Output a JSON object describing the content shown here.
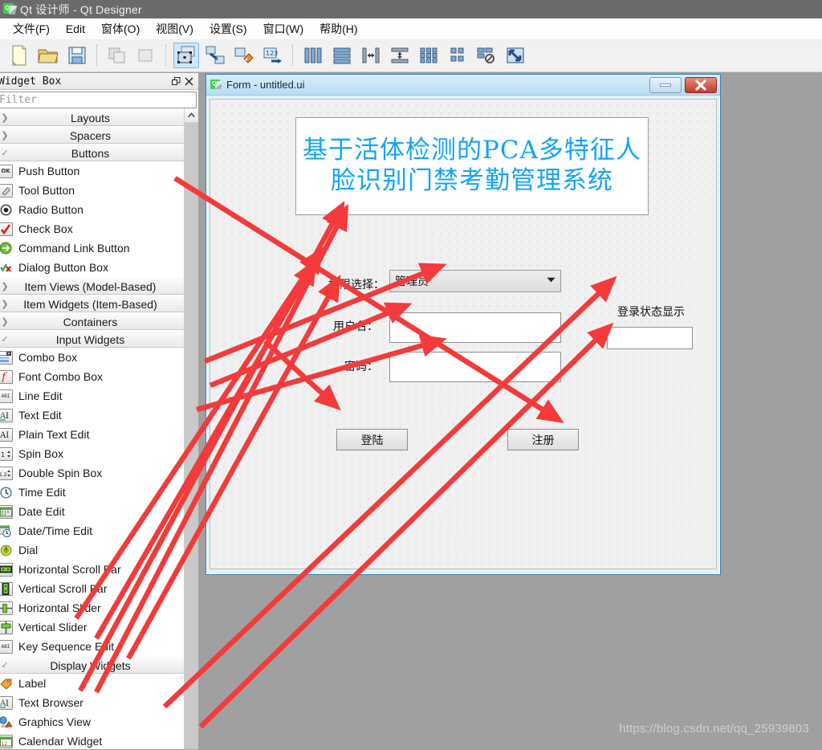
{
  "app": {
    "title": "Qt 设计师 - Qt Designer",
    "logo_text": "Qt"
  },
  "menubar": {
    "items": [
      {
        "label": "文件(F)",
        "mnemonic": "F"
      },
      {
        "label": "Edit",
        "mnemonic": "E"
      },
      {
        "label": "窗体(O)",
        "mnemonic": "O"
      },
      {
        "label": "视图(V)",
        "mnemonic": "V"
      },
      {
        "label": "设置(S)",
        "mnemonic": "S"
      },
      {
        "label": "窗口(W)",
        "mnemonic": "W"
      },
      {
        "label": "帮助(H)",
        "mnemonic": "H"
      }
    ]
  },
  "toolbar": {
    "buttons": [
      {
        "icon": "new-file-icon",
        "active": false
      },
      {
        "icon": "open-folder-icon",
        "active": false
      },
      {
        "icon": "save-icon",
        "active": false
      },
      {
        "icon": "undo-icon",
        "active": false
      },
      {
        "icon": "redo-icon",
        "active": false
      },
      {
        "icon": "edit-widgets-icon",
        "active": true
      },
      {
        "icon": "edit-signals-slots-icon",
        "active": false
      },
      {
        "icon": "edit-buddies-icon",
        "active": false
      },
      {
        "icon": "edit-tab-order-icon",
        "active": false
      },
      {
        "icon": "layout-horizontally-icon",
        "active": false
      },
      {
        "icon": "layout-vertically-icon",
        "active": false
      },
      {
        "icon": "layout-splitter-horizontal-icon",
        "active": false
      },
      {
        "icon": "layout-splitter-vertical-icon",
        "active": false
      },
      {
        "icon": "layout-grid-icon",
        "active": false
      },
      {
        "icon": "layout-form-icon",
        "active": false
      },
      {
        "icon": "break-layout-icon",
        "active": false
      },
      {
        "icon": "adjust-size-icon",
        "active": false
      }
    ]
  },
  "widget_box": {
    "title": "Widget Box",
    "filter_placeholder": "Filter",
    "float_icon": "float-icon",
    "close_icon": "close-icon",
    "scroll_up_icon": "chevron-up-icon",
    "entries": [
      {
        "kind": "category",
        "label": "Layouts",
        "expanded": false
      },
      {
        "kind": "category",
        "label": "Spacers",
        "expanded": false
      },
      {
        "kind": "category",
        "label": "Buttons",
        "expanded": true
      },
      {
        "kind": "item",
        "label": "Push Button",
        "icon": "push-button-icon"
      },
      {
        "kind": "item",
        "label": "Tool Button",
        "icon": "tool-button-icon"
      },
      {
        "kind": "item",
        "label": "Radio Button",
        "icon": "radio-button-icon"
      },
      {
        "kind": "item",
        "label": "Check Box",
        "icon": "check-box-icon"
      },
      {
        "kind": "item",
        "label": "Command Link Button",
        "icon": "command-link-button-icon"
      },
      {
        "kind": "item",
        "label": "Dialog Button Box",
        "icon": "dialog-button-box-icon"
      },
      {
        "kind": "category",
        "label": "Item Views (Model-Based)",
        "expanded": false
      },
      {
        "kind": "category",
        "label": "Item Widgets (Item-Based)",
        "expanded": false
      },
      {
        "kind": "category",
        "label": "Containers",
        "expanded": false
      },
      {
        "kind": "category",
        "label": "Input Widgets",
        "expanded": true
      },
      {
        "kind": "item",
        "label": "Combo Box",
        "icon": "combo-box-icon"
      },
      {
        "kind": "item",
        "label": "Font Combo Box",
        "icon": "font-combo-box-icon"
      },
      {
        "kind": "item",
        "label": "Line Edit",
        "icon": "line-edit-icon"
      },
      {
        "kind": "item",
        "label": "Text Edit",
        "icon": "text-edit-icon"
      },
      {
        "kind": "item",
        "label": "Plain Text Edit",
        "icon": "plain-text-edit-icon"
      },
      {
        "kind": "item",
        "label": "Spin Box",
        "icon": "spin-box-icon"
      },
      {
        "kind": "item",
        "label": "Double Spin Box",
        "icon": "double-spin-box-icon"
      },
      {
        "kind": "item",
        "label": "Time Edit",
        "icon": "time-edit-icon"
      },
      {
        "kind": "item",
        "label": "Date Edit",
        "icon": "date-edit-icon"
      },
      {
        "kind": "item",
        "label": "Date/Time Edit",
        "icon": "date-time-edit-icon"
      },
      {
        "kind": "item",
        "label": "Dial",
        "icon": "dial-icon"
      },
      {
        "kind": "item",
        "label": "Horizontal Scroll Bar",
        "icon": "horizontal-scroll-bar-icon"
      },
      {
        "kind": "item",
        "label": "Vertical Scroll Bar",
        "icon": "vertical-scroll-bar-icon"
      },
      {
        "kind": "item",
        "label": "Horizontal Slider",
        "icon": "horizontal-slider-icon"
      },
      {
        "kind": "item",
        "label": "Vertical Slider",
        "icon": "vertical-slider-icon"
      },
      {
        "kind": "item",
        "label": "Key Sequence Edit",
        "icon": "key-sequence-edit-icon"
      },
      {
        "kind": "category",
        "label": "Display Widgets",
        "expanded": true
      },
      {
        "kind": "item",
        "label": "Label",
        "icon": "label-icon"
      },
      {
        "kind": "item",
        "label": "Text Browser",
        "icon": "text-browser-icon"
      },
      {
        "kind": "item",
        "label": "Graphics View",
        "icon": "graphics-view-icon"
      },
      {
        "kind": "item",
        "label": "Calendar Widget",
        "icon": "calendar-widget-icon"
      }
    ]
  },
  "form_window": {
    "title": "Form - untitled.ui",
    "minimize_icon": "minimize-icon",
    "close_icon": "close-icon",
    "title_label": "基于活体检测的PCA多特征人脸识别门禁考勤管理系统",
    "title_label_color": "#12a5f4",
    "fields": {
      "auth_label": "权限选择：",
      "auth_value": "管理员",
      "auth_arrow_icon": "chevron-down-icon",
      "username_label": "用户名：",
      "username_value": "",
      "password_label": "密码：",
      "password_value": "",
      "status_label": "登录状态显示",
      "status_value": ""
    },
    "buttons": {
      "login": "登陆",
      "register": "注册"
    }
  },
  "watermark": "https://blog.csdn.net/qq_25939803",
  "annotation_color": "#f43a3a"
}
